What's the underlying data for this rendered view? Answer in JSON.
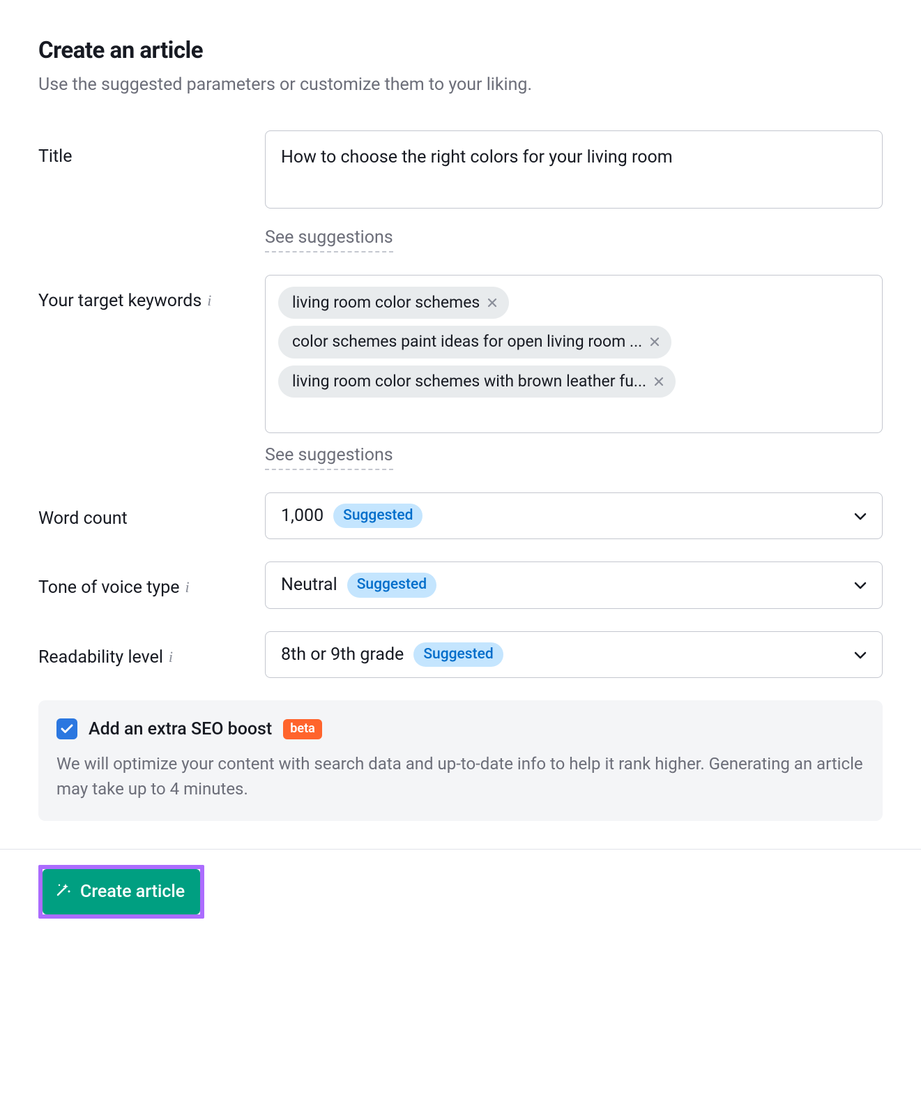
{
  "header": {
    "title": "Create an article",
    "subtitle": "Use the suggested parameters or customize them to your liking."
  },
  "labels": {
    "title": "Title",
    "keywords": "Your target keywords",
    "word_count": "Word count",
    "tone": "Tone of voice type",
    "readability": "Readability level"
  },
  "fields": {
    "title_value": "How to choose the right colors for your living room",
    "see_suggestions": "See suggestions",
    "keywords": [
      "living room color schemes",
      "color schemes paint ideas for open living room ...",
      "living room color schemes with brown leather fu..."
    ],
    "word_count": {
      "value": "1,000",
      "badge": "Suggested"
    },
    "tone": {
      "value": "Neutral",
      "badge": "Suggested"
    },
    "readability": {
      "value": "8th or 9th grade",
      "badge": "Suggested"
    }
  },
  "seo": {
    "checkbox_checked": true,
    "label": "Add an extra SEO boost",
    "badge": "beta",
    "description": "We will optimize your content with search data and up-to-date info to help it rank higher. Generating an article may take up to 4 minutes."
  },
  "actions": {
    "create": "Create article"
  },
  "icons": {
    "info": "i"
  }
}
